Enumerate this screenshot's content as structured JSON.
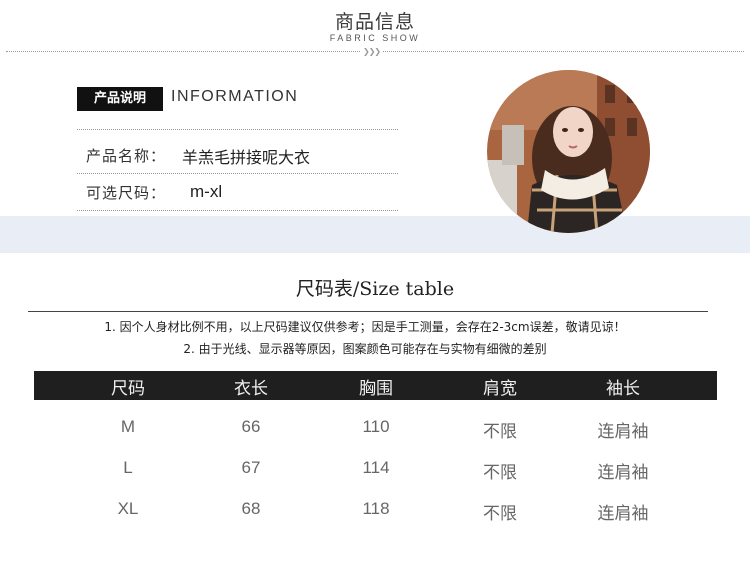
{
  "header": {
    "title": "商品信息",
    "subtitle": "FABRIC SHOW",
    "arrows": "❯❯❯"
  },
  "product_info": {
    "badge": "产品说明",
    "heading": "INFORMATION",
    "name_label": "产品名称：",
    "name_value": "羊羔毛拼接呢大衣",
    "size_label": "可选尺码：",
    "size_value": "m-xl"
  },
  "size_table": {
    "title": "尺码表/Size table",
    "notes": [
      "1. 因个人身材比例不用，以上尺码建议仅供参考；因是手工测量，会存在2-3cm误差，敬请见谅！",
      "2. 由于光线、显示器等原因，图案颜色可能存在与实物有细微的差别"
    ],
    "headers": [
      "尺码",
      "衣长",
      "胸围",
      "肩宽",
      "袖长"
    ],
    "rows": [
      [
        "M",
        "66",
        "110",
        "不限",
        "连肩袖"
      ],
      [
        "L",
        "67",
        "114",
        "不限",
        "连肩袖"
      ],
      [
        "XL",
        "68",
        "118",
        "不限",
        "连肩袖"
      ]
    ]
  },
  "colors": {
    "band": "#e9eef6",
    "dark": "#1f1f1f",
    "text": "#333333"
  }
}
